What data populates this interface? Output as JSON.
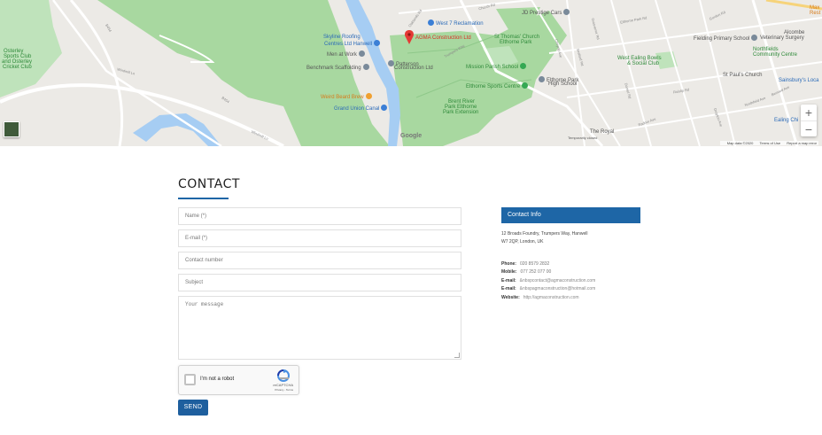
{
  "map": {
    "places": {
      "agma": "AGMA Construction Ltd",
      "west7": "West 7 Reclamation",
      "skyline1": "Skyline Roofing",
      "skyline2": "Centres Ltd Hanwell",
      "menatwork": "Men at Work",
      "benchmark": "Benchmark Scaffolding",
      "patterson1": "Patterson",
      "patterson2": "Construction Ltd",
      "weirdbeard": "Weird Beard Brew",
      "grandunion": "Grand Union Canal",
      "jdprestige": "JD Prestige Cars",
      "stthomas1": "St Thomas' Church",
      "stthomas2": "Elthorne Park",
      "missionparish": "Mission Parish School",
      "elthorne1": "Elthorne Park",
      "elthorne2": "High School",
      "elthornesports": "Elthorne Sports Centre",
      "brent1": "Brent River",
      "brent2": "Park Elthorne",
      "brent3": "Park Extension",
      "theroyal": "The Royal",
      "theroyal2": "Temporarily closed",
      "westealing1": "West Ealing Bowls",
      "westealing2": "& Social Club",
      "fielding": "Fielding Primary School",
      "alcombe1": "Alcombe",
      "alcombe2": "Veterinary Surgery",
      "northfields1": "Northfields",
      "northfields2": "Community Centre",
      "stpauls": "St Paul's Church",
      "sainsburys": "Sainsbury's Loca",
      "ealingchi": "Ealing Chi",
      "max1": "Max",
      "max2": "Rest",
      "osterley1": "Osterley",
      "osterley2": "Sports Club",
      "osterley3": "and Osterley",
      "osterley4": "Cricket Club",
      "windmill": "Windmill Ln",
      "windmill2": "Windmill Ln",
      "b454": "B454",
      "b454b": "B454",
      "google": "Google"
    },
    "streets": [
      "Oaklands Rd",
      "Trumpers Way",
      "Elthorne Park Rd",
      "Ruislip Rd",
      "Cheyne Ave",
      "Seaford Rd",
      "Northfield Ave",
      "Dorset Rd",
      "Grosvenor Rd",
      "Drayton Ave",
      "Church Rd",
      "Radnor Ave",
      "Gordon Rd",
      "Bernard Ave"
    ],
    "footer": {
      "data": "Map data ©2020",
      "terms": "Terms of Use",
      "report": "Report a map error"
    },
    "zoom_in": "+",
    "zoom_out": "−"
  },
  "contact": {
    "title": "CONTACT",
    "fields": {
      "name": "Name (*)",
      "email": "E-mail (*)",
      "phone": "Contact number",
      "subject": "Subject",
      "message": "Your message"
    },
    "recaptcha": {
      "label": "I'm not a robot",
      "brand": "reCAPTCHA",
      "terms": "Privacy - Terms"
    },
    "send_label": "SEND"
  },
  "info": {
    "header": "Contact Info",
    "address_line1": "12 Broads Foundry, Trumpers Way, Hanwell",
    "address_line2": "W7 2QP, London, UK",
    "rows": [
      {
        "label": "Phone:",
        "value": "020 8579 2832"
      },
      {
        "label": "Mobile:",
        "value": "077 252 077 00"
      },
      {
        "label": "E-mail:",
        "value": "&nbspcontact@agmaconstruction.com"
      },
      {
        "label": "E-mail:",
        "value": "&nbspagmaconstruction@hotmail.com"
      },
      {
        "label": "Website:",
        "value": "http://agmaconstruction.com"
      }
    ]
  },
  "colors": {
    "accent": "#1e66a6",
    "send": "#1e5f9e",
    "park": "#a8d8a0",
    "water": "#a6cdf3"
  }
}
